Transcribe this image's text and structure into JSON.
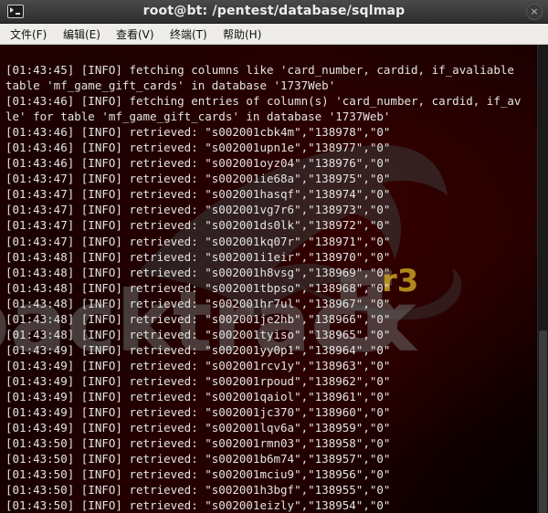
{
  "window": {
    "title": "root@bt: /pentest/database/sqlmap",
    "close_symbol": "×"
  },
  "menu": [
    "文件(F)",
    "编辑(E)",
    "查看(V)",
    "终端(T)",
    "帮助(H)"
  ],
  "watermark": {
    "text": "backtrack",
    "version": "5",
    "release": "r3"
  },
  "terminal": {
    "lines": [
      "[01:43:45] [INFO] fetching columns like 'card_number, cardid, if_avaliable",
      "table 'mf_game_gift_cards' in database '1737Web'",
      "[01:43:46] [INFO] fetching entries of column(s) 'card_number, cardid, if_av",
      "le' for table 'mf_game_gift_cards' in database '1737Web'",
      "[01:43:46] [INFO] retrieved: \"s002001cbk4m\",\"138978\",\"0\"",
      "[01:43:46] [INFO] retrieved: \"s002001upn1e\",\"138977\",\"0\"",
      "[01:43:46] [INFO] retrieved: \"s002001oyz04\",\"138976\",\"0\"",
      "[01:43:47] [INFO] retrieved: \"s002001ie68a\",\"138975\",\"0\"",
      "[01:43:47] [INFO] retrieved: \"s002001hasqf\",\"138974\",\"0\"",
      "[01:43:47] [INFO] retrieved: \"s002001vg7r6\",\"138973\",\"0\"",
      "[01:43:47] [INFO] retrieved: \"s002001ds0lk\",\"138972\",\"0\"",
      "[01:43:47] [INFO] retrieved: \"s002001kq07r\",\"138971\",\"0\"",
      "[01:43:48] [INFO] retrieved: \"s002001i1eir\",\"138970\",\"0\"",
      "[01:43:48] [INFO] retrieved: \"s002001h8vsg\",\"138969\",\"0\"",
      "[01:43:48] [INFO] retrieved: \"s002001tbpso\",\"138968\",\"0\"",
      "[01:43:48] [INFO] retrieved: \"s002001hr7ul\",\"138967\",\"0\"",
      "[01:43:48] [INFO] retrieved: \"s002001je2hb\",\"138966\",\"0\"",
      "[01:43:48] [INFO] retrieved: \"s002001tyiso\",\"138965\",\"0\"",
      "[01:43:49] [INFO] retrieved: \"s002001yy0p1\",\"138964\",\"0\"",
      "[01:43:49] [INFO] retrieved: \"s002001rcv1y\",\"138963\",\"0\"",
      "[01:43:49] [INFO] retrieved: \"s002001rpoud\",\"138962\",\"0\"",
      "[01:43:49] [INFO] retrieved: \"s002001qaiol\",\"138961\",\"0\"",
      "[01:43:49] [INFO] retrieved: \"s002001jc370\",\"138960\",\"0\"",
      "[01:43:49] [INFO] retrieved: \"s002001lqv6a\",\"138959\",\"0\"",
      "[01:43:50] [INFO] retrieved: \"s002001rmn03\",\"138958\",\"0\"",
      "[01:43:50] [INFO] retrieved: \"s002001b6m74\",\"138957\",\"0\"",
      "[01:43:50] [INFO] retrieved: \"s002001mciu9\",\"138956\",\"0\"",
      "[01:43:50] [INFO] retrieved: \"s002001h3bgf\",\"138955\",\"0\"",
      "[01:43:50] [INFO] retrieved: \"s002001eizly\",\"138954\",\"0\""
    ]
  },
  "colors": {
    "text": "#e4e4e4",
    "background": "#1a0000",
    "accent": "#c8a020"
  }
}
